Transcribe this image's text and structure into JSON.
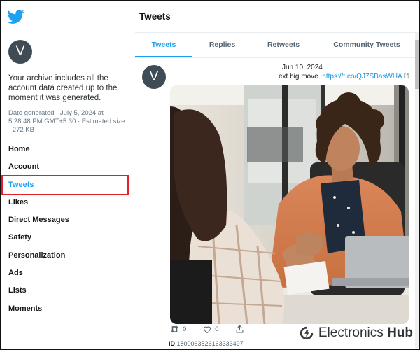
{
  "sidebar": {
    "avatar_letter": "V",
    "archive_text": "Your archive includes all the account data created up to the moment it was generated.",
    "meta": "Date generated · July 5, 2024 at 5:28:48 PM GMT+5:30 · Estimated size · 272 KB",
    "items": [
      {
        "label": "Home"
      },
      {
        "label": "Account"
      },
      {
        "label": "Tweets",
        "active": true
      },
      {
        "label": "Likes"
      },
      {
        "label": "Direct Messages"
      },
      {
        "label": "Safety"
      },
      {
        "label": "Personalization"
      },
      {
        "label": "Ads"
      },
      {
        "label": "Lists"
      },
      {
        "label": "Moments"
      }
    ]
  },
  "main": {
    "title": "Tweets",
    "tabs": [
      {
        "label": "Tweets",
        "active": true
      },
      {
        "label": "Replies"
      },
      {
        "label": "Retweets"
      },
      {
        "label": "Community Tweets"
      }
    ],
    "tweet": {
      "avatar_letter": "V",
      "date": "Jun 10, 2024",
      "text_prefix": "ext big move.",
      "link": "https://t.co/QJ7SBasWHA",
      "retweets": "0",
      "likes": "0",
      "id_label": "ID",
      "id_value": "1800063526163333497"
    }
  },
  "watermark": {
    "part1": "Electronics",
    "part2": "Hub"
  },
  "colors": {
    "accent": "#1da1f2",
    "highlight_box": "#e0212b",
    "avatar_bg": "#3f4b55"
  },
  "icons": [
    "twitter-bird-icon",
    "retweet-icon",
    "heart-icon",
    "share-icon",
    "external-link-icon",
    "electronics-hub-logo-icon"
  ]
}
